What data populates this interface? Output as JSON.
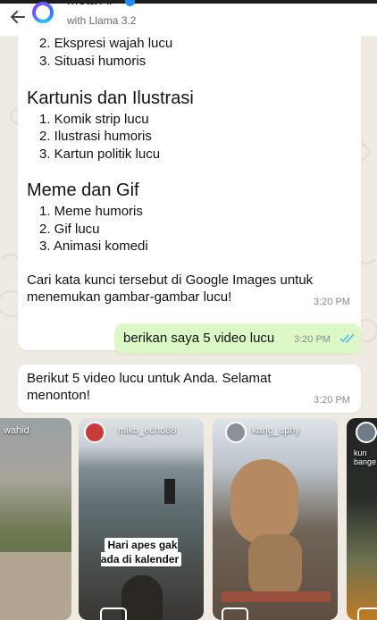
{
  "header": {
    "title": "Meta AI",
    "subtitle": "with Llama 3.2"
  },
  "message_list": {
    "section1_items": [
      "2. Ekspresi wajah lucu",
      "3. Situasi humoris"
    ],
    "section2_heading": "Kartunis dan Ilustrasi",
    "section2_items": [
      "1. Komik strip lucu",
      "2. Ilustrasi humoris",
      "3. Kartun politik lucu"
    ],
    "section3_heading": "Meme dan Gif",
    "section3_items": [
      "1. Meme humoris",
      "2. Gif lucu",
      "3. Animasi komedi"
    ],
    "closing": "Cari kata kunci tersebut di Google Images untuk menemukan gambar-gambar lucu!",
    "time": "3:20 PM"
  },
  "user_message": {
    "text": "berikan saya 5 video lucu",
    "time": "3:20 PM"
  },
  "reply_message": {
    "text": "Berikut 5 video lucu untuk Anda. Selamat menonton!",
    "time": "3:20 PM"
  },
  "videos": [
    {
      "user": "wahid"
    },
    {
      "user": "miko_echo88",
      "caption": "Hari apes gak ada di kalender"
    },
    {
      "user": "kang_uphy"
    },
    {
      "user": "kun bange"
    }
  ],
  "colors": {
    "chat_bg": "#efeae2",
    "outgoing_bubble": "#dcf8c6",
    "incoming_bubble": "#ffffff",
    "read_ticks": "#53bdeb"
  }
}
